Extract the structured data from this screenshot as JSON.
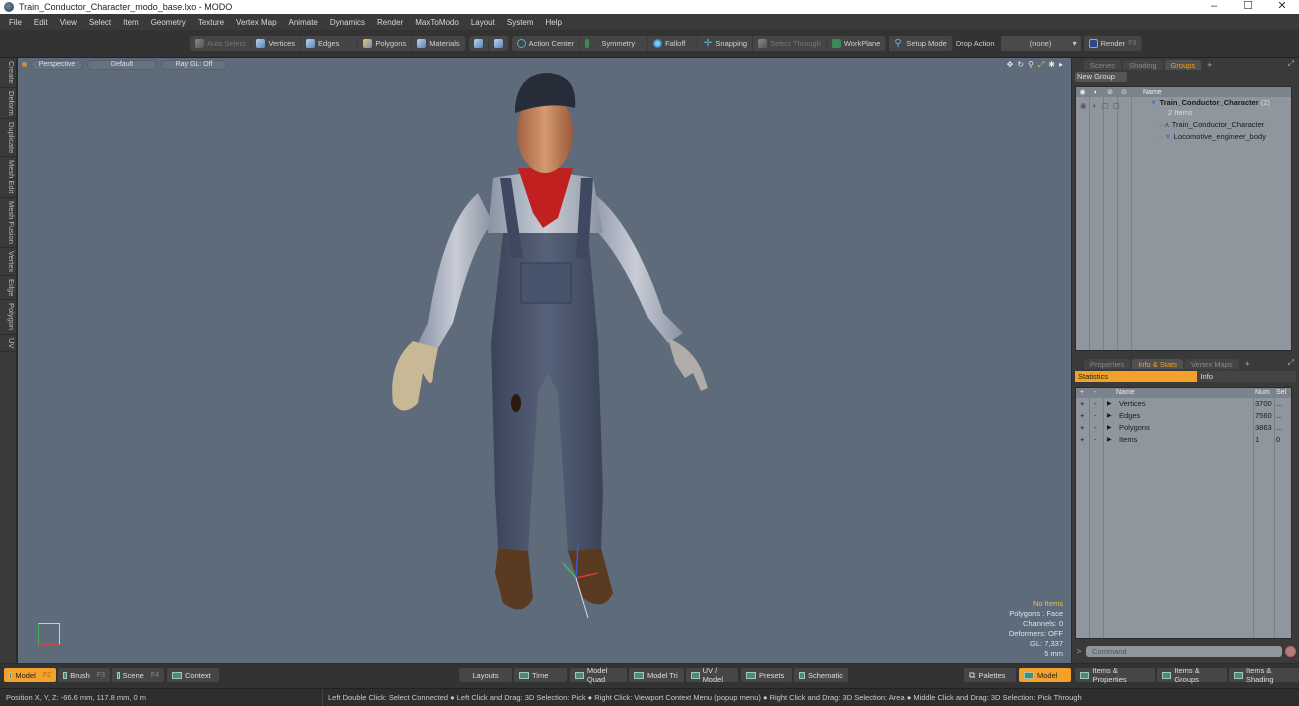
{
  "window": {
    "title": "Train_Conductor_Character_modo_base.lxo - MODO",
    "controls": [
      "minimize",
      "maximize",
      "close"
    ]
  },
  "menu": [
    "File",
    "Edit",
    "View",
    "Select",
    "Item",
    "Geometry",
    "Texture",
    "Vertex Map",
    "Animate",
    "Dynamics",
    "Render",
    "MaxToModo",
    "Layout",
    "System",
    "Help"
  ],
  "toolbar": {
    "auto_select": "Auto Select",
    "vertices": "Vertices",
    "edges": "Edges",
    "polygons": "Polygons",
    "materials": "Materials",
    "action_center": "Action Center",
    "symmetry": "Symmetry",
    "falloff": "Falloff",
    "snapping": "Snapping",
    "select_through": "Select Through",
    "workplane": "WorkPlane",
    "setup_mode": "Setup Mode",
    "drop_action_label": "Drop Action",
    "drop_action_value": "(none)",
    "render": "Render",
    "render_shortcut": "F9"
  },
  "left_tabs": [
    "Create",
    "Deform",
    "Duplicate",
    "Mesh Edit",
    "Mesh Fusion",
    "Vertex",
    "Edge",
    "Polygon",
    "UV"
  ],
  "viewport": {
    "view": "Perspective",
    "shading": "Default",
    "raygl": "Ray GL: Off",
    "stats": {
      "selection": "No Items",
      "mode": "Polygons : Face",
      "channels": "Channels: 0",
      "deformers": "Deformers: OFF",
      "gl": "GL: 7,337",
      "scale": "5 mm"
    },
    "icons": [
      "move-view-icon",
      "rotate-view-icon",
      "zoom-view-icon",
      "fit-view-icon",
      "settings-icon",
      "more-icon"
    ]
  },
  "groups_panel": {
    "tabs": [
      "Scenes",
      "Shading",
      "Groups"
    ],
    "active_tab": "Groups",
    "new_group": "New Group",
    "column_name": "Name",
    "root": {
      "name": "Train_Conductor_Character",
      "count": "(2)",
      "sub": "2 Items"
    },
    "children": [
      "Train_Conductor_Character",
      "Locomotive_engineer_body"
    ]
  },
  "info_panel": {
    "tabs": [
      "Properties",
      "Info & Stats",
      "Vertex Maps"
    ],
    "active_tab": "Info & Stats",
    "subtabs": [
      "Statistics",
      "Info"
    ],
    "columns": {
      "plus": "+",
      "minus": "-",
      "name": "Name",
      "num": "Num",
      "sel": "Sel"
    },
    "rows": [
      {
        "name": "Vertices",
        "num": "3700",
        "sel": "..."
      },
      {
        "name": "Edges",
        "num": "7560",
        "sel": "..."
      },
      {
        "name": "Polygons",
        "num": "3863",
        "sel": "..."
      },
      {
        "name": "Items",
        "num": "1",
        "sel": "0"
      }
    ]
  },
  "command": {
    "prompt": ">",
    "placeholder": "Command"
  },
  "bottom_left": [
    {
      "label": "Model",
      "key": "F2",
      "active": true
    },
    {
      "label": "Brush",
      "key": "F3"
    },
    {
      "label": "Scene",
      "key": "F4"
    },
    {
      "label": "Context",
      "key": ""
    }
  ],
  "bottom_center": [
    "Layouts",
    "Time",
    "Model Quad",
    "Model Tri",
    "UV / Model",
    "Presets",
    "Schematic"
  ],
  "bottom_right": {
    "palettes": "Palettes",
    "layouts": [
      {
        "label": "Model",
        "active": true
      },
      {
        "label": "Items & Properties"
      },
      {
        "label": "Items & Groups"
      },
      {
        "label": "Items & Shading"
      }
    ]
  },
  "status": {
    "position": "Position X, Y, Z:   -66.6 mm, 117.8 mm, 0 m",
    "hint": "Left Double Click: Select Connected ● Left Click and Drag: 3D Selection: Pick ● Right Click: Viewport Context Menu (popup menu) ● Right Click and Drag: 3D Selection: Area ● Middle Click and Drag: 3D Selection: Pick Through"
  },
  "colors": {
    "accent": "#f2a22a",
    "viewport_bg": "#5d6b7b",
    "panel_list_bg": "#8f969e",
    "highlight_text": "#f0c23a"
  }
}
